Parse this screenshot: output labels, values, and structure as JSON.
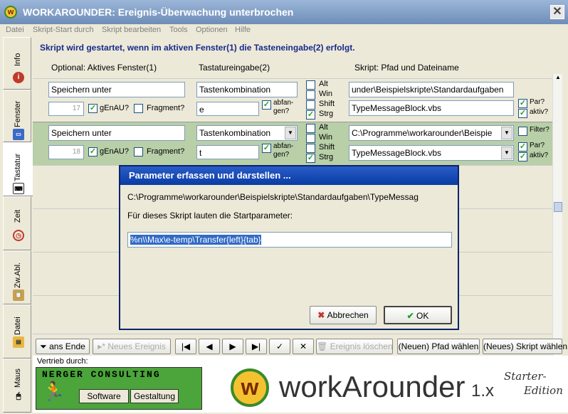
{
  "window": {
    "title": "WORKAROUNDER: Ereignis-Überwachung unterbrochen",
    "close": "✕"
  },
  "menu": [
    "Datei",
    "Skript-Start durch",
    "Skript bearbeiten",
    "Tools",
    "Optionen",
    "Hilfe"
  ],
  "left_tabs": [
    {
      "label": "Info",
      "icon": "info-icon"
    },
    {
      "label": "Fenster",
      "icon": "window-icon"
    },
    {
      "label": "Tastatur",
      "icon": "keyboard-icon"
    },
    {
      "label": "Zeit",
      "icon": "clock-icon"
    },
    {
      "label": "Zw.Abl.",
      "icon": "clipboard-icon"
    },
    {
      "label": "Datei",
      "icon": "file-icon"
    },
    {
      "label": "Maus",
      "icon": "mouse-icon"
    }
  ],
  "header": "Skript wird gestartet, wenn im aktiven Fenster(1) die Tasteneingabe(2) erfolgt.",
  "columns": {
    "c1": "Optional: Aktives Fenster(1)",
    "c2": "Tastatureingabe(2)",
    "c3": "Skript: Pfad und Dateiname"
  },
  "rows": [
    {
      "window": "Speichern unter",
      "number": "17",
      "genau_label": "gEnAU?",
      "fragment_label": "Fragment?",
      "key_type": "Tastenkombination",
      "key": "e",
      "abfangen": "abfan-gen?",
      "mods": [
        "Alt",
        "Win",
        "Shift",
        "Strg"
      ],
      "path": "under\\Beispielskripte\\Standardaufgaben",
      "script": "TypeMessageBlock.vbs",
      "par": "Par?",
      "aktiv": "aktiv?"
    },
    {
      "window": "Speichern unter",
      "number": "18",
      "genau_label": "gEnAU?",
      "fragment_label": "Fragment?",
      "key_type": "Tastenkombination",
      "key": "t",
      "abfangen": "abfan-gen?",
      "mods": [
        "Alt",
        "Win",
        "Shift",
        "Strg"
      ],
      "path": "C:\\Programme\\workarounder\\Beispie",
      "script": "TypeMessageBlock.vbs",
      "filter": "Filter?",
      "par": "Par?",
      "aktiv": "aktiv?"
    }
  ],
  "toolbar": {
    "ans_ende": "ans Ende",
    "neues_ereignis": "Neues Ereignis",
    "ereignis_loeschen": "Ereignis löschen",
    "neuen_pfad": "(Neuen) Pfad wählen",
    "neues_skript": "(Neues) Skript wählen",
    "nav_first": "|◀",
    "nav_prev": "◀",
    "nav_next": "▶",
    "nav_last": "▶|",
    "confirm": "✓",
    "cancel": "✕"
  },
  "dialog": {
    "title": "Parameter erfassen und darstellen ...",
    "path": "C:\\Programme\\workarounder\\Beispielskripte\\Standardaufgaben\\TypeMessag",
    "info": "Für dieses Skript lauten die Startparameter:",
    "value": "%n\\\\Max\\e-temp\\Transfer{left}{tab}",
    "cancel": "Abbrechen",
    "ok": "OK"
  },
  "footer": {
    "vertrieb": "Vertrieb durch:",
    "company": "Nerger Consulting",
    "software": "Software",
    "gestaltung": "Gestaltung",
    "brand_w": "w",
    "brand": "workArounder",
    "version": "1.x",
    "edition_1": "Starter-",
    "edition_2": "Edition"
  },
  "colors": {
    "accent": "#1a2a8a",
    "row_green": "#B8CFA8",
    "dialog_title": "#0A3CA4"
  }
}
